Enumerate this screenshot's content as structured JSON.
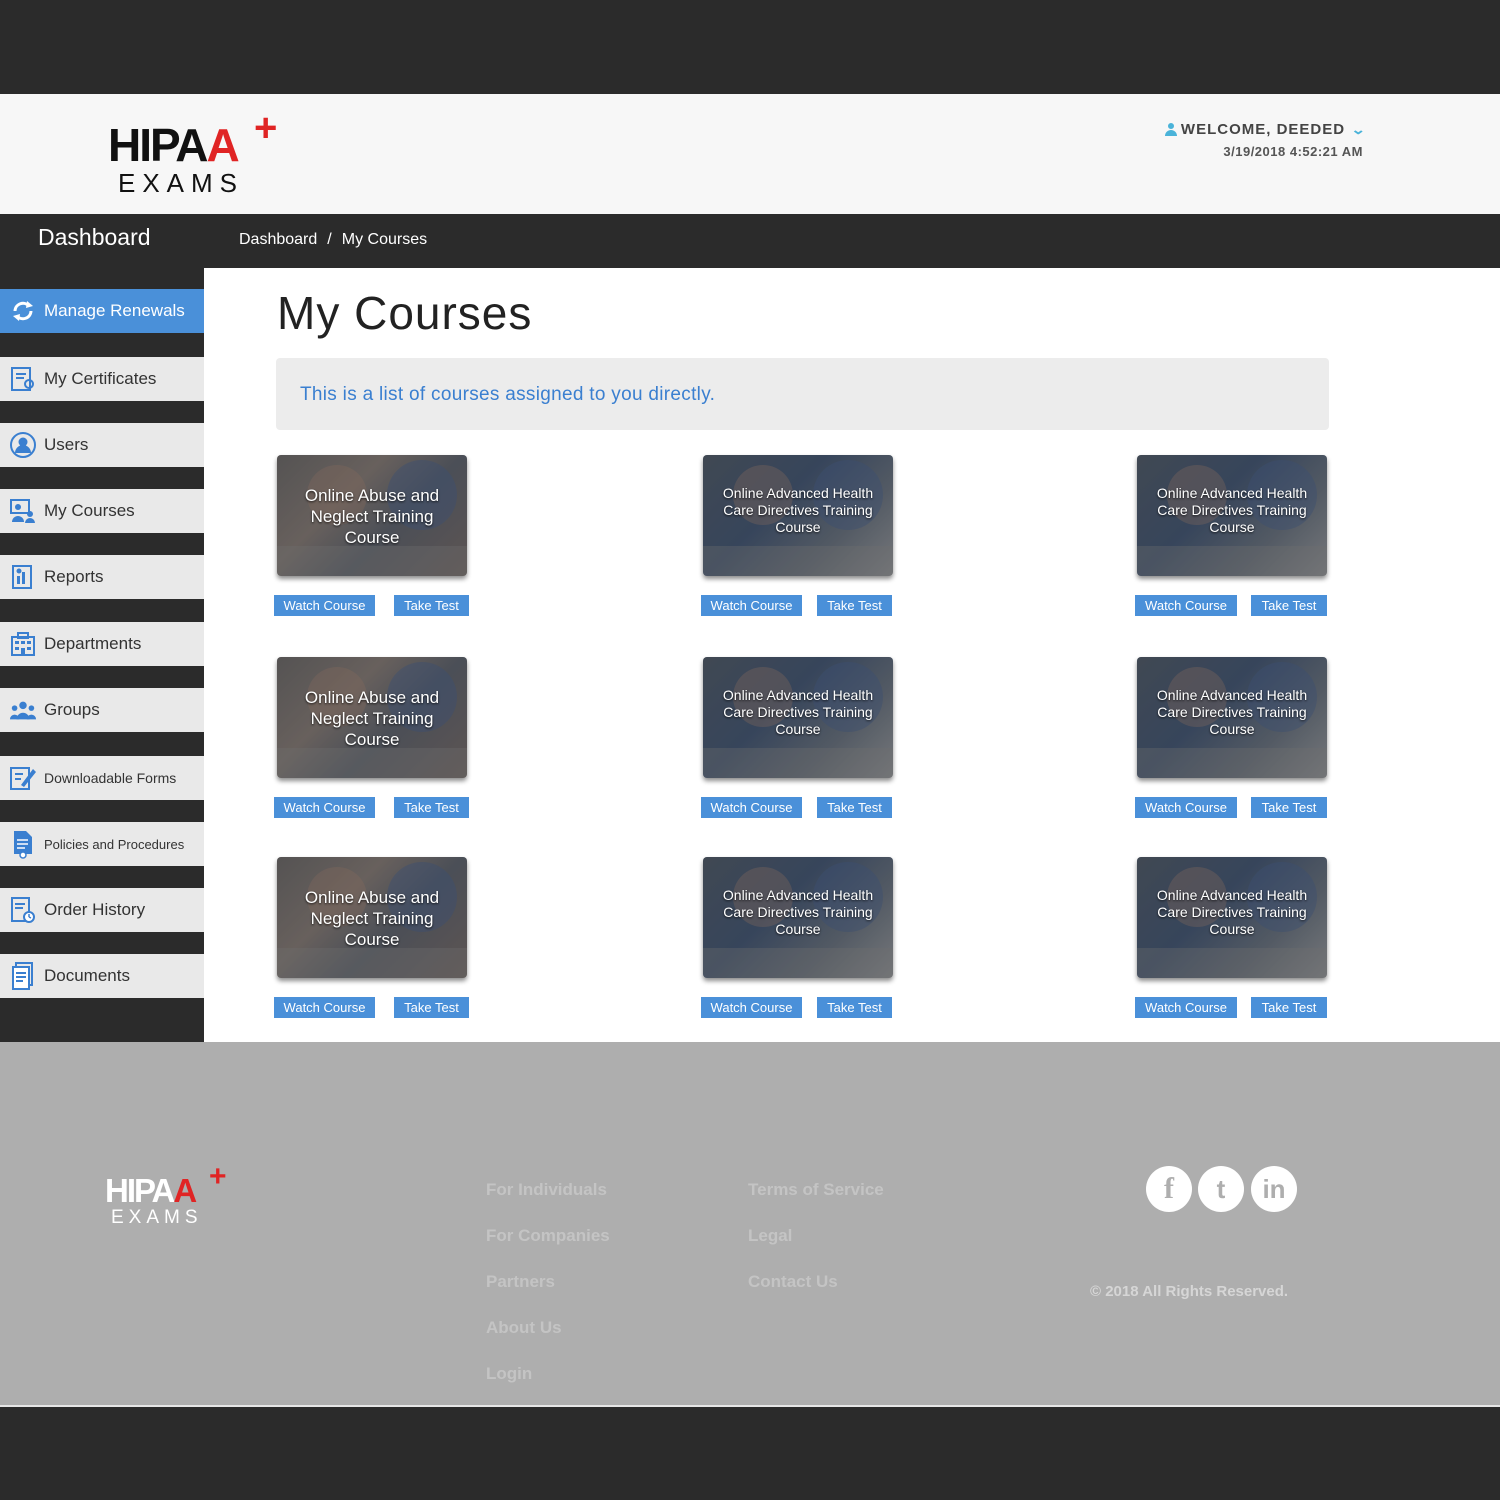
{
  "header": {
    "logo_main": "HIPAA",
    "logo_sub": "EXAMS",
    "welcome": "WELCOME, DEEDED",
    "datetime": "3/19/2018 4:52:21 AM"
  },
  "topbar": {
    "title": "Dashboard",
    "breadcrumb": [
      "Dashboard",
      "/",
      "My Courses"
    ]
  },
  "sidebar": {
    "items": [
      {
        "label": "Manage Renewals",
        "icon": "refresh-icon",
        "active": true
      },
      {
        "label": "My Certificates",
        "icon": "certificate-icon"
      },
      {
        "label": "Users",
        "icon": "user-icon"
      },
      {
        "label": "My Courses",
        "icon": "courses-icon"
      },
      {
        "label": "Reports",
        "icon": "report-icon"
      },
      {
        "label": "Departments",
        "icon": "building-icon"
      },
      {
        "label": "Groups",
        "icon": "group-icon"
      },
      {
        "label": "Downloadable Forms",
        "icon": "form-edit-icon"
      },
      {
        "label": "Policies and Procedures",
        "icon": "policy-icon"
      },
      {
        "label": "Order History",
        "icon": "order-history-icon"
      },
      {
        "label": "Documents",
        "icon": "document-icon"
      }
    ]
  },
  "main": {
    "title": "My Courses",
    "info": "This is a list of courses assigned to you directly.",
    "watch_label": "Watch Course",
    "test_label": "Take Test",
    "courses": [
      {
        "title": "Online Abuse and Neglect Training Course"
      },
      {
        "title": "Online Advanced Health Care Directives Training Course"
      },
      {
        "title": "Online Advanced Health Care Directives Training Course"
      },
      {
        "title": "Online Abuse and Neglect Training Course"
      },
      {
        "title": "Online Advanced Health Care Directives Training Course"
      },
      {
        "title": "Online Advanced Health Care Directives Training Course"
      },
      {
        "title": "Online Abuse and Neglect Training Course"
      },
      {
        "title": "Online Advanced Health Care Directives Training Course"
      },
      {
        "title": "Online Advanced Health Care Directives Training Course"
      }
    ]
  },
  "footer": {
    "logo_main": "HIPAA",
    "logo_sub": "EXAMS",
    "links_col1": [
      "For Individuals",
      "For Companies",
      "Partners",
      "About Us",
      "Login"
    ],
    "links_col2": [
      "Terms of Service",
      "Legal",
      "Contact Us"
    ],
    "social": [
      "f",
      "t",
      "in"
    ],
    "copyright": "© 2018 All Rights Reserved."
  },
  "colors": {
    "accent": "#4a90d9",
    "brand_red": "#e02424",
    "dark": "#2b2b2b",
    "footer_bg": "#aeaeae"
  }
}
